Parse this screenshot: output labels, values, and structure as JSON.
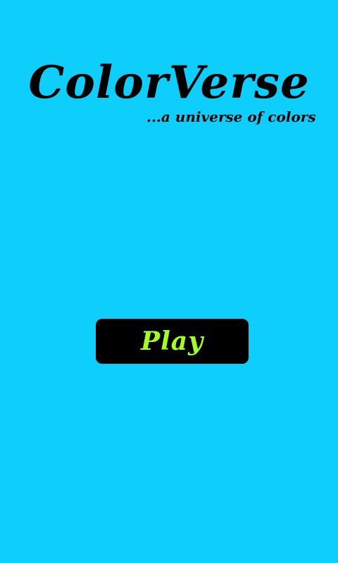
{
  "app": {
    "title": "ColorVerse",
    "tagline": "...a universe of colors"
  },
  "menu": {
    "play_label": "Play"
  },
  "colors": {
    "background": "#0ecffb",
    "title_text": "#000000",
    "button_background": "#000000",
    "button_text": "#a3ff1a"
  }
}
